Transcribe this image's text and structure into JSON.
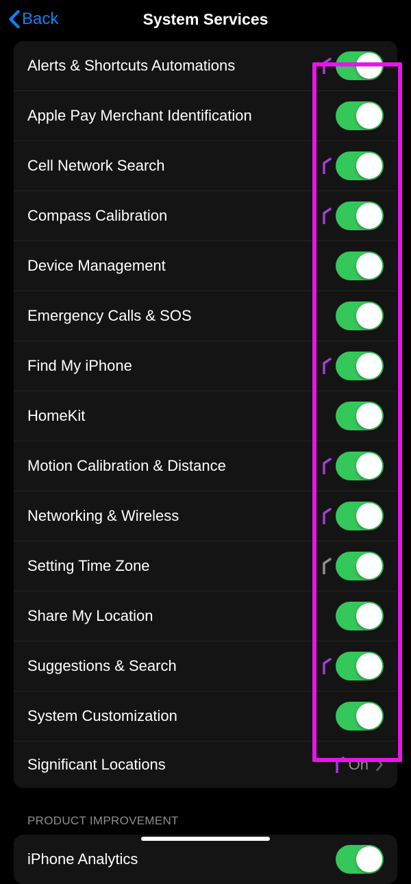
{
  "header": {
    "back_label": "Back",
    "title": "System Services"
  },
  "section1": {
    "rows": [
      {
        "label": "Alerts & Shortcuts Automations",
        "has_arrow": true,
        "arrow_color": "#a63dd6",
        "toggle": true
      },
      {
        "label": "Apple Pay Merchant Identification",
        "has_arrow": false,
        "toggle": true
      },
      {
        "label": "Cell Network Search",
        "has_arrow": true,
        "arrow_color": "#a63dd6",
        "toggle": true
      },
      {
        "label": "Compass Calibration",
        "has_arrow": true,
        "arrow_color": "#a63dd6",
        "toggle": true
      },
      {
        "label": "Device Management",
        "has_arrow": false,
        "toggle": true
      },
      {
        "label": "Emergency Calls & SOS",
        "has_arrow": false,
        "toggle": true
      },
      {
        "label": "Find My iPhone",
        "has_arrow": true,
        "arrow_color": "#a63dd6",
        "toggle": true
      },
      {
        "label": "HomeKit",
        "has_arrow": false,
        "toggle": true
      },
      {
        "label": "Motion Calibration & Distance",
        "has_arrow": true,
        "arrow_color": "#a63dd6",
        "toggle": true
      },
      {
        "label": "Networking & Wireless",
        "has_arrow": true,
        "arrow_color": "#a63dd6",
        "toggle": true
      },
      {
        "label": "Setting Time Zone",
        "has_arrow": true,
        "arrow_color": "#8e8e93",
        "toggle": true
      },
      {
        "label": "Share My Location",
        "has_arrow": false,
        "toggle": true
      },
      {
        "label": "Suggestions & Search",
        "has_arrow": true,
        "arrow_color": "#a63dd6",
        "toggle": true
      },
      {
        "label": "System Customization",
        "has_arrow": false,
        "toggle": true
      },
      {
        "label": "Significant Locations",
        "has_arrow": true,
        "arrow_color": "#a63dd6",
        "detail": "On",
        "disclosure": true
      }
    ]
  },
  "section2": {
    "header": "PRODUCT IMPROVEMENT",
    "rows": [
      {
        "label": "iPhone Analytics",
        "has_arrow": false,
        "toggle": true
      }
    ]
  }
}
